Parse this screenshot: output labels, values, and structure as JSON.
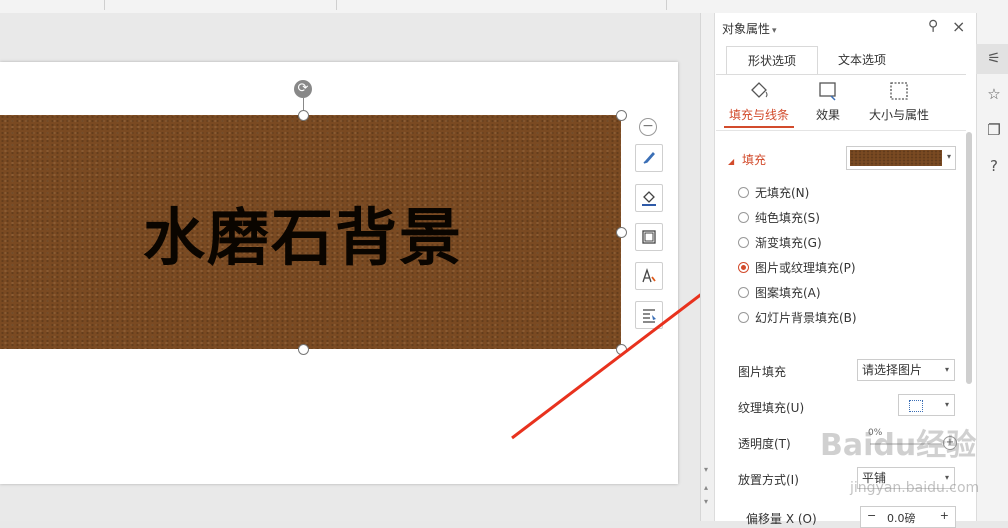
{
  "panel": {
    "title": "对象属性",
    "title_arrow": "▾",
    "tabs": [
      {
        "label": "形状选项"
      },
      {
        "label": "文本选项"
      }
    ],
    "subtabs": [
      {
        "label": "填充与线条"
      },
      {
        "label": "效果"
      },
      {
        "label": "大小与属性"
      }
    ],
    "fill_section": "填充",
    "fill_options": [
      {
        "label": "无填充(N)",
        "selected": false
      },
      {
        "label": "纯色填充(S)",
        "selected": false
      },
      {
        "label": "渐变填充(G)",
        "selected": false
      },
      {
        "label": "图片或纹理填充(P)",
        "selected": true
      },
      {
        "label": "图案填充(A)",
        "selected": false
      },
      {
        "label": "幻灯片背景填充(B)",
        "selected": false
      }
    ],
    "picture_fill_label": "图片填充",
    "picture_fill_value": "请选择图片",
    "texture_fill_label": "纹理填充(U)",
    "transparency_label": "透明度(T)",
    "transparency_value": "0%",
    "placement_label": "放置方式(I)",
    "placement_value": "平铺",
    "offset_label": "偏移量 X (O)",
    "offset_value": "0.0磅"
  },
  "slide": {
    "text": "水磨石背景"
  },
  "watermark": {
    "brand": "Baidu经验",
    "url": "jingyan.baidu.com"
  },
  "colors": {
    "accent": "#d24b2c",
    "leather": "#7a4a22",
    "arrow": "#e8321e"
  },
  "icons": {
    "pin": "pin-icon",
    "close": "close-icon",
    "fill_line": "paint-bucket-icon",
    "effect": "effect-icon",
    "size": "size-icon"
  }
}
